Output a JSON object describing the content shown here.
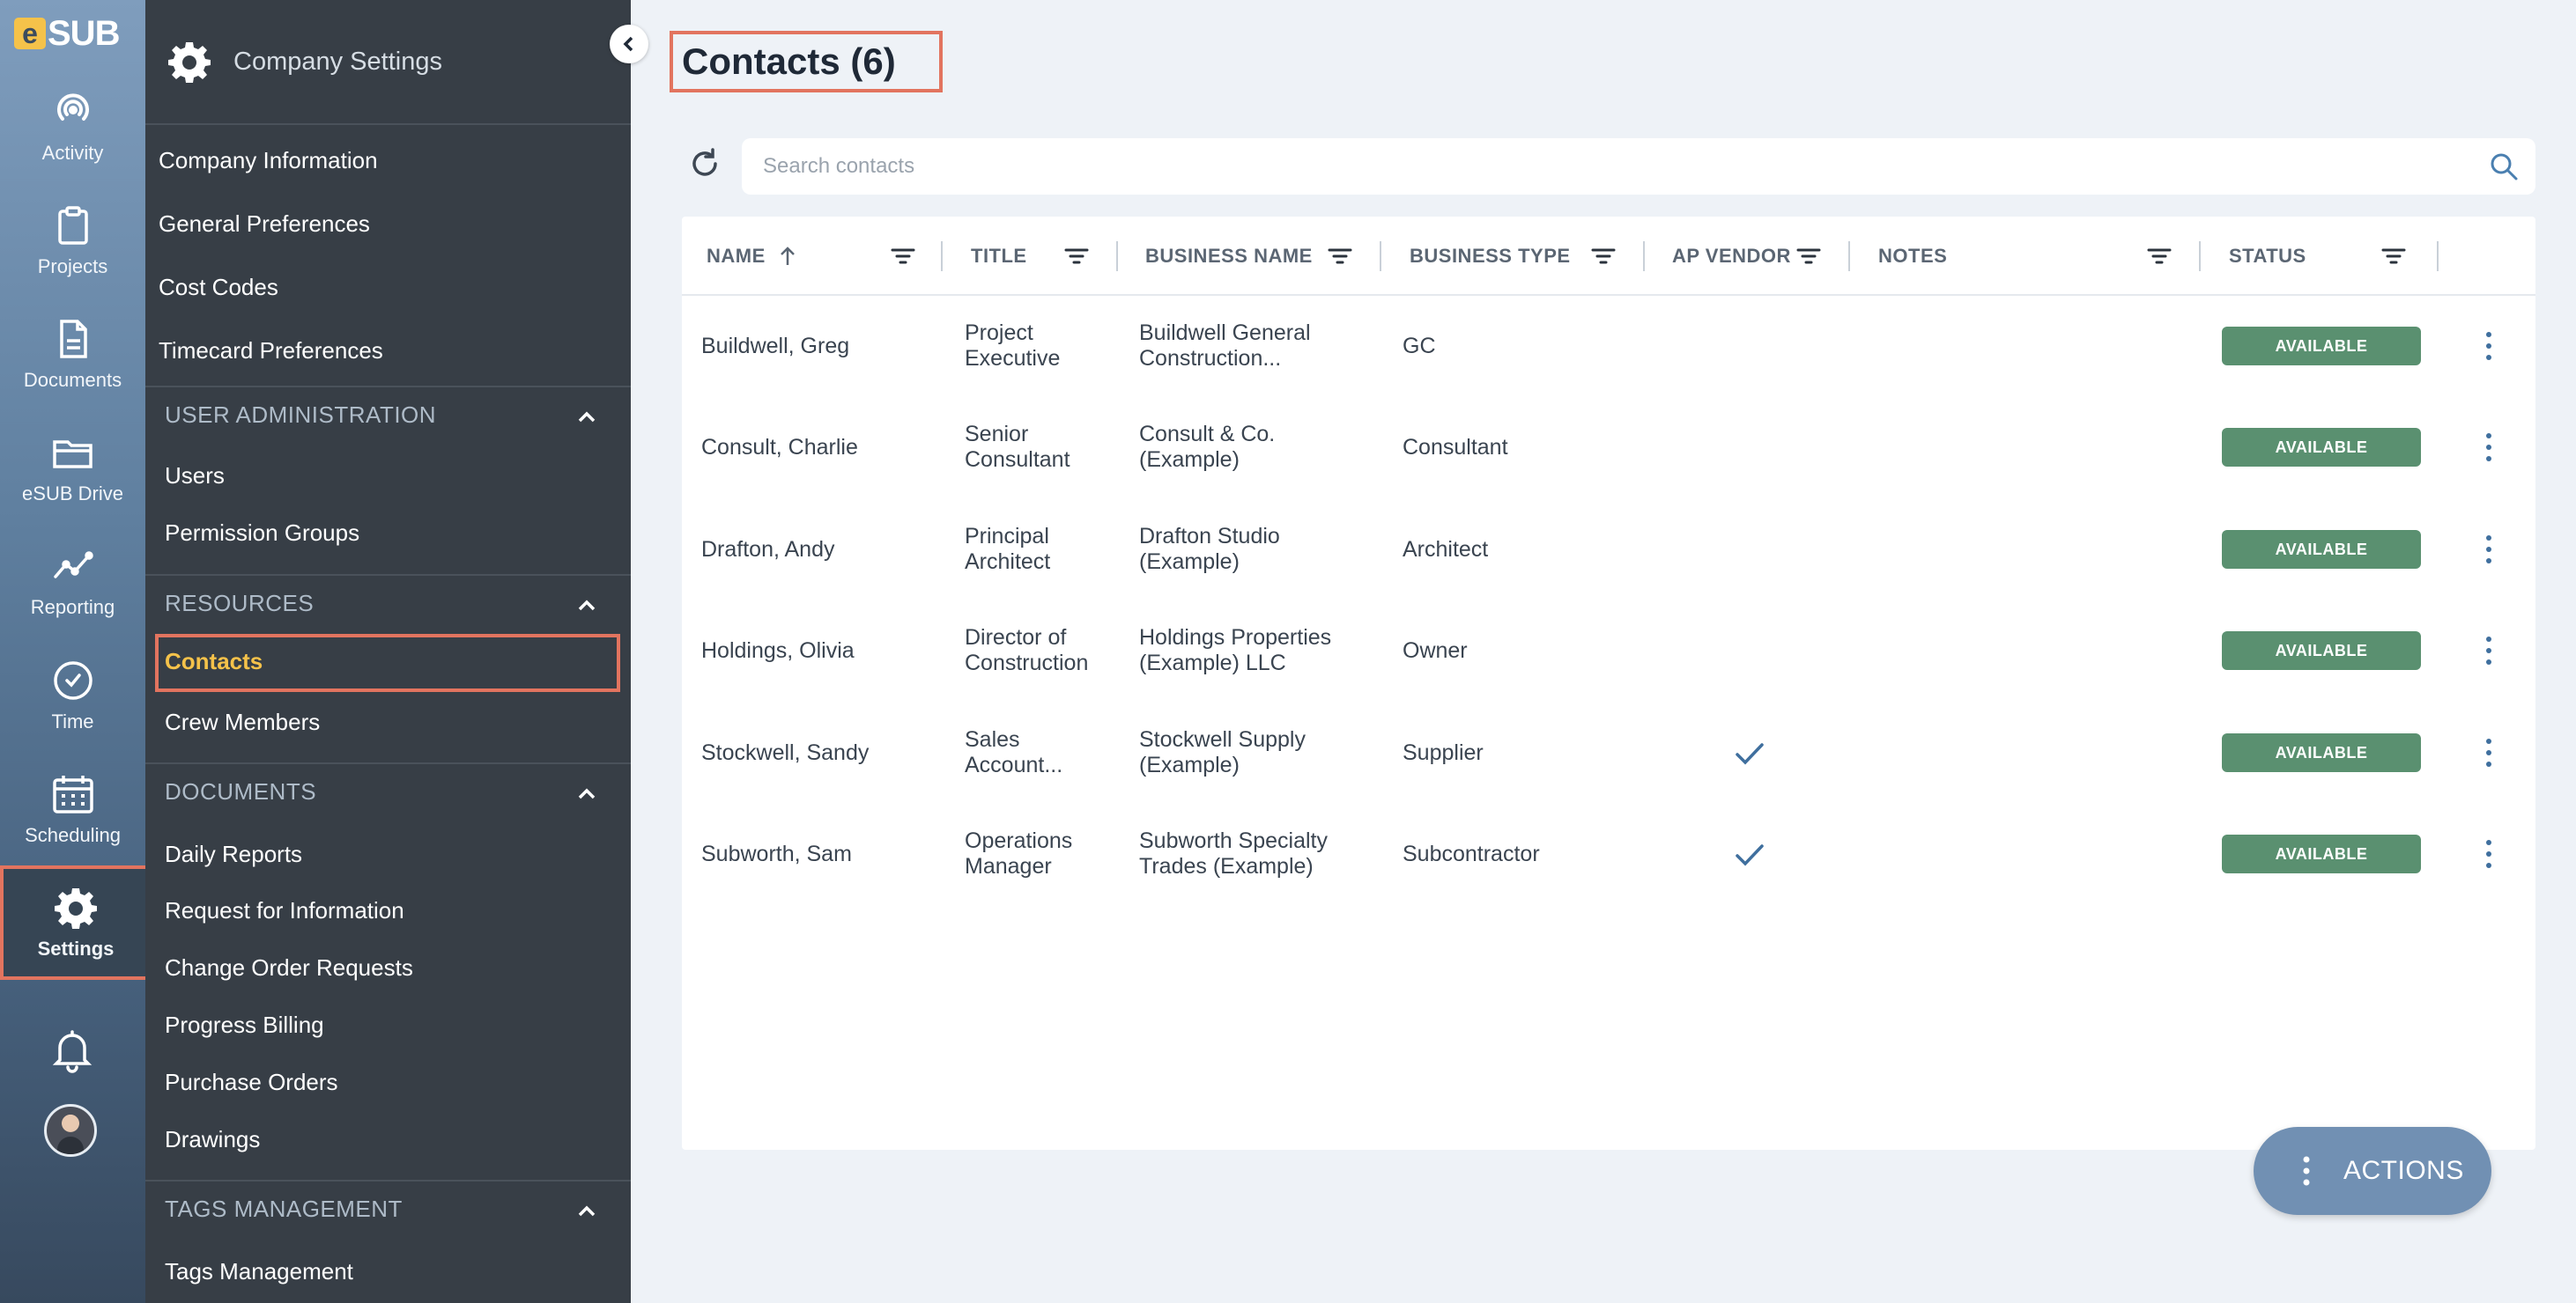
{
  "app": {
    "logo_e": "e",
    "logo_text": "SUB"
  },
  "rail": [
    {
      "label": "Activity",
      "icon": "activity-icon"
    },
    {
      "label": "Projects",
      "icon": "clipboard-icon"
    },
    {
      "label": "Documents",
      "icon": "document-icon"
    },
    {
      "label": "eSUB Drive",
      "icon": "folder-icon"
    },
    {
      "label": "Reporting",
      "icon": "chart-line-icon"
    },
    {
      "label": "Time",
      "icon": "clock-icon"
    },
    {
      "label": "Scheduling",
      "icon": "calendar-icon"
    },
    {
      "label": "Settings",
      "icon": "gear-icon",
      "active": true
    }
  ],
  "panel": {
    "title": "Company Settings",
    "top_links": [
      "Company Information",
      "General Preferences",
      "Cost Codes",
      "Timecard Preferences"
    ],
    "sections": [
      {
        "title": "USER ADMINISTRATION",
        "items": [
          "Users",
          "Permission Groups"
        ]
      },
      {
        "title": "RESOURCES",
        "items": [
          "Contacts",
          "Crew Members"
        ],
        "active_item": "Contacts"
      },
      {
        "title": "DOCUMENTS",
        "items": [
          "Daily Reports",
          "Request for Information",
          "Change Order Requests",
          "Progress Billing",
          "Purchase Orders",
          "Drawings"
        ]
      },
      {
        "title": "TAGS MANAGEMENT",
        "items": [
          "Tags Management"
        ]
      }
    ]
  },
  "main": {
    "title": "Contacts (6)",
    "search_placeholder": "Search contacts",
    "columns": [
      "NAME",
      "TITLE",
      "BUSINESS NAME",
      "BUSINESS TYPE",
      "AP VENDOR",
      "NOTES",
      "STATUS"
    ],
    "rows": [
      {
        "name": "Buildwell, Greg",
        "title": [
          "Project",
          "Executive"
        ],
        "business": [
          "Buildwell General",
          "Construction..."
        ],
        "type": "GC",
        "ap_vendor": false,
        "notes": "",
        "status": "AVAILABLE"
      },
      {
        "name": "Consult, Charlie",
        "title": [
          "Senior",
          "Consultant"
        ],
        "business": [
          "Consult & Co.",
          "(Example)"
        ],
        "type": "Consultant",
        "ap_vendor": false,
        "notes": "",
        "status": "AVAILABLE"
      },
      {
        "name": "Drafton, Andy",
        "title": [
          "Principal",
          "Architect"
        ],
        "business": [
          "Drafton Studio",
          "(Example)"
        ],
        "type": "Architect",
        "ap_vendor": false,
        "notes": "",
        "status": "AVAILABLE"
      },
      {
        "name": "Holdings, Olivia",
        "title": [
          "Director of",
          "Construction"
        ],
        "business": [
          "Holdings Properties",
          "(Example) LLC"
        ],
        "type": "Owner",
        "ap_vendor": false,
        "notes": "",
        "status": "AVAILABLE"
      },
      {
        "name": "Stockwell, Sandy",
        "title": [
          "Sales",
          "Account..."
        ],
        "business": [
          "Stockwell Supply",
          "(Example)"
        ],
        "type": "Supplier",
        "ap_vendor": true,
        "notes": "",
        "status": "AVAILABLE"
      },
      {
        "name": "Subworth, Sam",
        "title": [
          "Operations",
          "Manager"
        ],
        "business": [
          "Subworth Specialty",
          "Trades (Example)"
        ],
        "type": "Subcontractor",
        "ap_vendor": true,
        "notes": "",
        "status": "AVAILABLE"
      }
    ],
    "actions_label": "ACTIONS"
  },
  "colors": {
    "highlight": "#e2745f",
    "active_link": "#f5c24a",
    "status_green": "#5a9070",
    "panel_bg": "#373e46",
    "actions_bg": "#7190b3"
  }
}
